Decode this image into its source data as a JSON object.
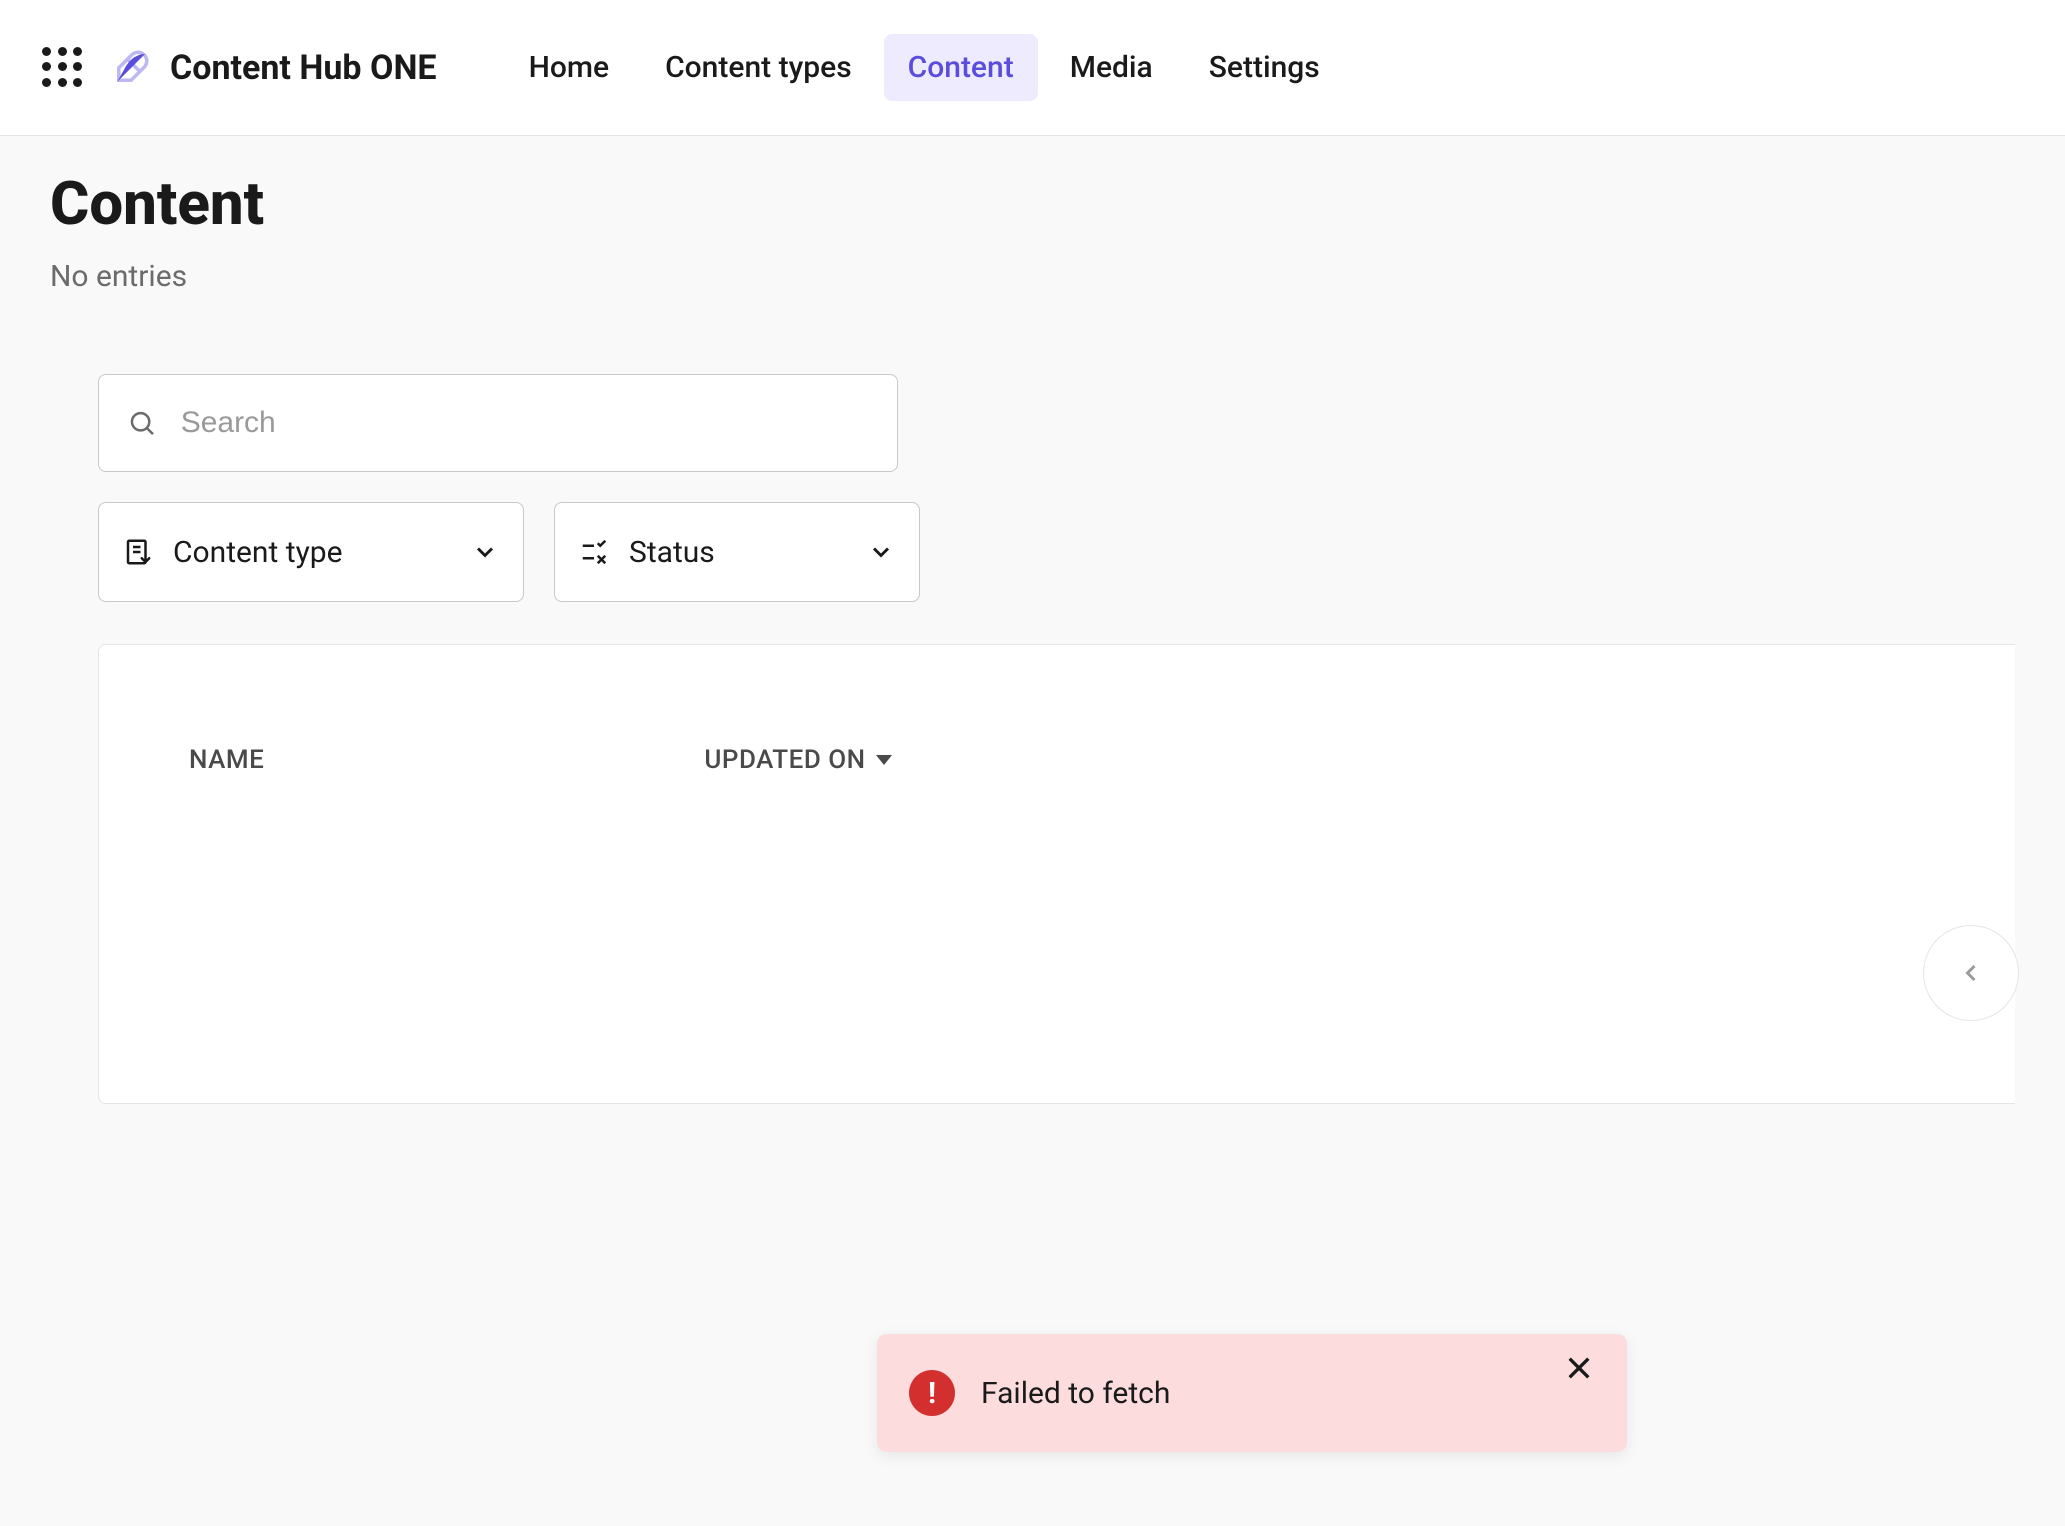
{
  "header": {
    "brand": "Content Hub ONE",
    "nav": [
      {
        "label": "Home"
      },
      {
        "label": "Content types"
      },
      {
        "label": "Content"
      },
      {
        "label": "Media"
      },
      {
        "label": "Settings"
      }
    ],
    "active_nav_index": 2
  },
  "page": {
    "title": "Content",
    "subtitle": "No entries"
  },
  "search": {
    "placeholder": "Search",
    "value": ""
  },
  "filters": {
    "content_type_label": "Content type",
    "status_label": "Status"
  },
  "table": {
    "columns": [
      {
        "label": "NAME"
      },
      {
        "label": "UPDATED ON"
      }
    ],
    "sort_column_index": 1,
    "rows": []
  },
  "toast": {
    "message": "Failed to fetch",
    "type": "error"
  }
}
